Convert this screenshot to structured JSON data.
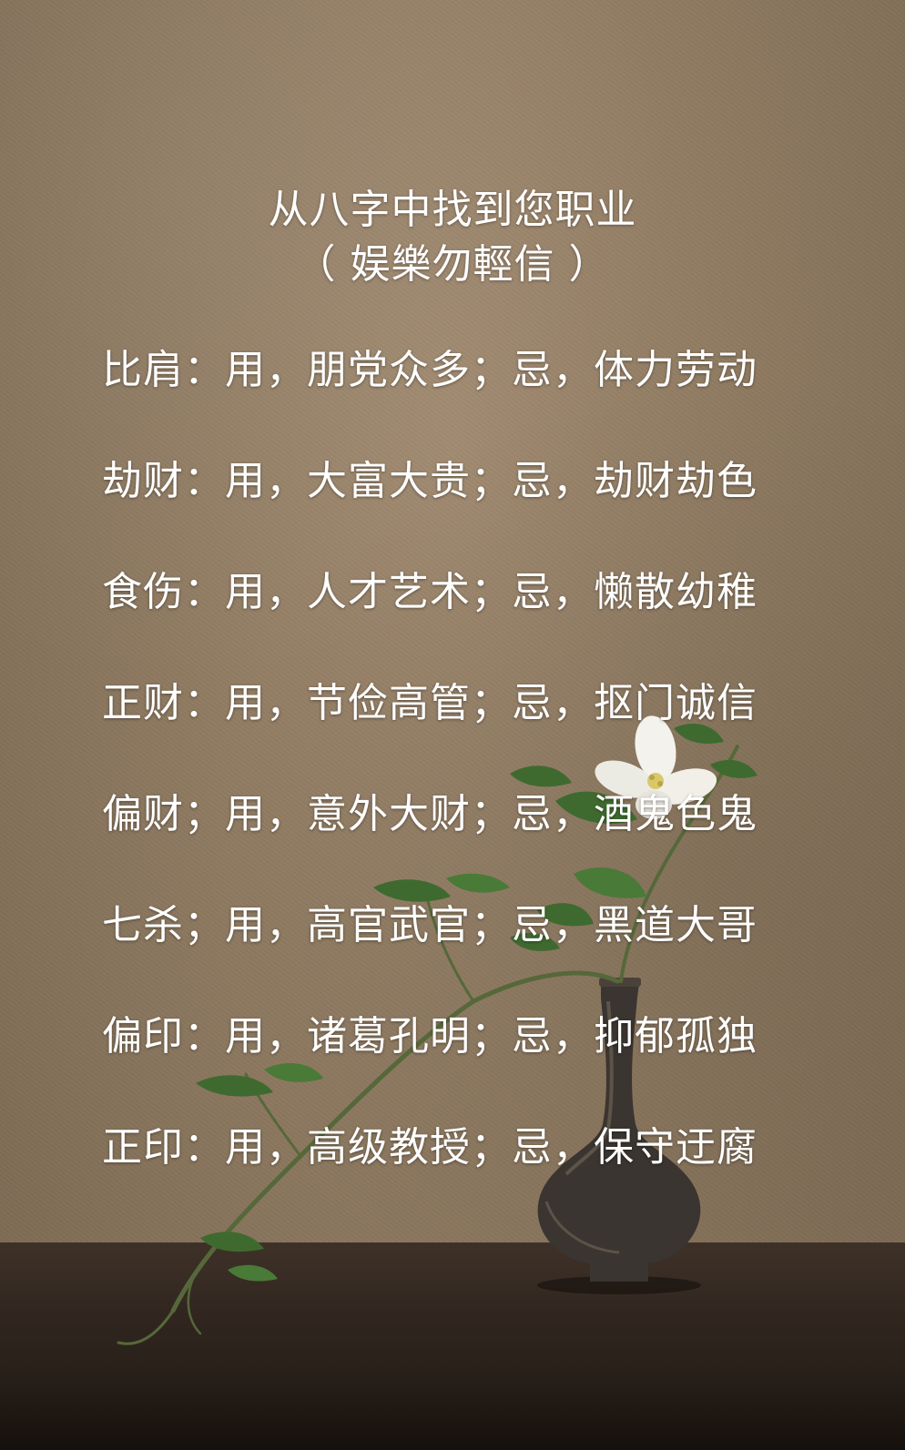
{
  "title": "从八字中找到您职业",
  "subtitle": "（ 娱樂勿輕信 ）",
  "rows": [
    "比肩：用，朋党众多；忌，体力劳动",
    "劫财：用，大富大贵；忌，劫财劫色",
    "食伤：用，人才艺术；忌，懒散幼稚",
    "正财：用，节俭高管；忌，抠门诚信",
    "偏财；用，意外大财；忌，酒鬼色鬼",
    "七杀；用，高官武官；忌，黑道大哥",
    "偏印：用，诸葛孔明；忌，抑郁孤独",
    "正印：用，高级教授；忌，保守迂腐"
  ],
  "colors": {
    "wall": "#8f7a61",
    "table": "#2f251e",
    "text": "#ffffff",
    "leaf": "#3f6a2f",
    "flower": "#f4f2ec",
    "vase": "#3a3530"
  },
  "icons": [
    "vase-illustration",
    "flower-illustration"
  ]
}
